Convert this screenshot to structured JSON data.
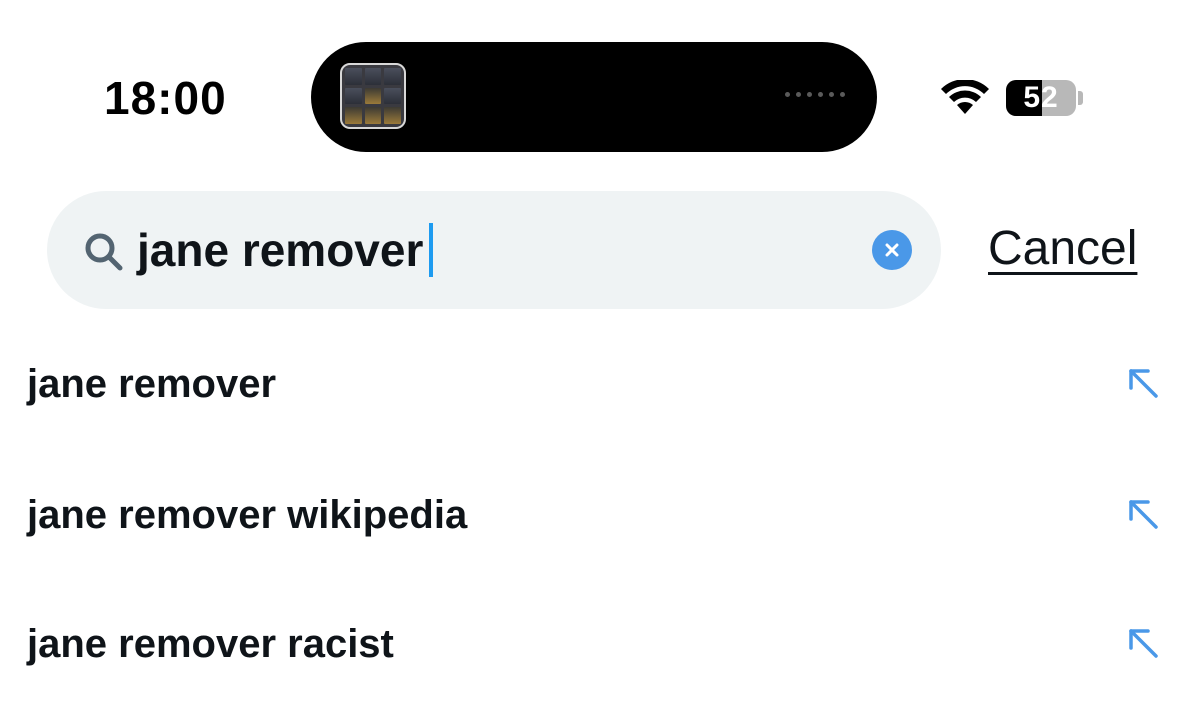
{
  "status_bar": {
    "time": "18:00",
    "battery_level": "52",
    "battery_fraction": 0.52
  },
  "search": {
    "query": "jane remover",
    "cancel_label": "Cancel"
  },
  "suggestions": [
    {
      "label": "jane remover"
    },
    {
      "label": "jane remover wikipedia"
    },
    {
      "label": "jane remover racist"
    }
  ],
  "colors": {
    "accent": "#4a98e8",
    "search_bg": "#eff3f4",
    "text": "#0f1419"
  },
  "icons": {
    "search": "search-icon",
    "clear": "clear-icon",
    "fill_suggestion": "arrow-up-left-icon",
    "wifi": "wifi-icon"
  }
}
